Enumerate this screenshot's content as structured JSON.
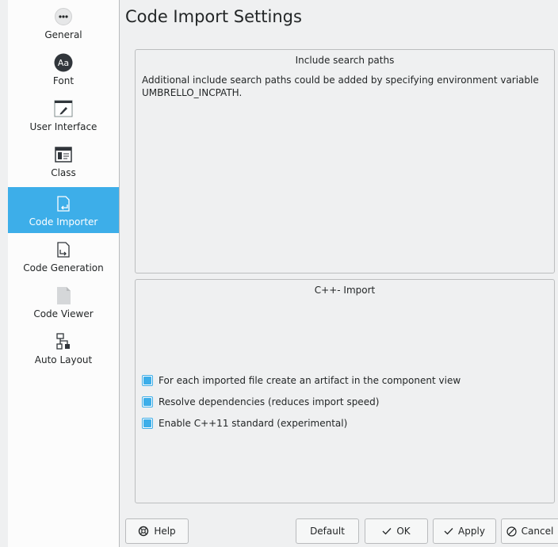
{
  "sidebar": {
    "items": [
      {
        "label": "General",
        "icon": "more-icon"
      },
      {
        "label": "Font",
        "icon": "font-icon"
      },
      {
        "label": "User Interface",
        "icon": "pencil-icon"
      },
      {
        "label": "Class",
        "icon": "class-icon"
      },
      {
        "label": "Code Importer",
        "icon": "code-import-icon"
      },
      {
        "label": "Code Generation",
        "icon": "code-generation-icon"
      },
      {
        "label": "Code Viewer",
        "icon": "document-icon"
      },
      {
        "label": "Auto Layout",
        "icon": "layout-icon"
      }
    ],
    "active_index": 4
  },
  "page_title": "Code Import Settings",
  "include_group": {
    "title": "Include search paths",
    "text": "Additional include search paths could be added by specifying environment variable UMBRELLO_INCPATH."
  },
  "cpp_group": {
    "title": "C++- Import",
    "options": [
      {
        "label": "For each imported file create an artifact in the component view",
        "checked": true
      },
      {
        "label": "Resolve dependencies (reduces import speed)",
        "checked": true
      },
      {
        "label": "Enable C++11 standard (experimental)",
        "checked": true
      }
    ]
  },
  "buttons": {
    "help": "Help",
    "default": "Default",
    "ok": "OK",
    "apply": "Apply",
    "cancel": "Cancel"
  },
  "colors": {
    "accent": "#3daee9",
    "background": "#eff0f1",
    "sidebar": "#fcfcfc",
    "text": "#232627"
  }
}
